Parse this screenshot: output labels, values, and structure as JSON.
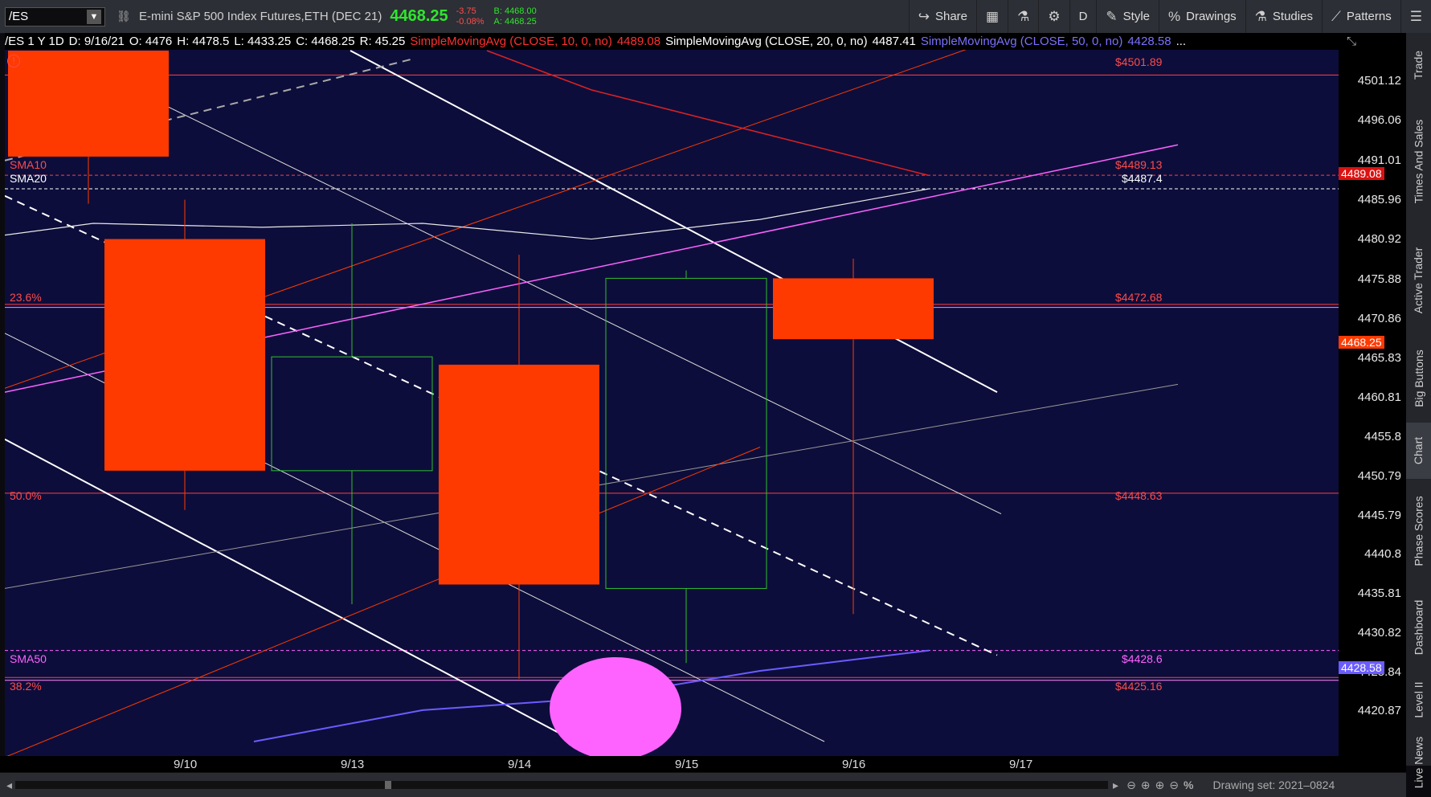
{
  "toolbar": {
    "symbol": "/ES",
    "description": "E-mini S&P 500 Index Futures,ETH (DEC 21)",
    "last": "4468.25",
    "change": "-3.75",
    "change_pct": "-0.08%",
    "bid": "B: 4468.00",
    "ask": "A: 4468.25",
    "share": "Share",
    "timeframe": "D",
    "style": "Style",
    "drawings": "Drawings",
    "studies": "Studies",
    "patterns": "Patterns"
  },
  "header": {
    "aggregation": "/ES 1 Y 1D",
    "date": "D: 9/16/21",
    "open": "O: 4476",
    "high": "H: 4478.5",
    "low": "L: 4433.25",
    "close": "C: 4468.25",
    "range": "R: 45.25",
    "sma10_label": "SimpleMovingAvg (CLOSE, 10, 0, no)",
    "sma10_value": "4489.08",
    "sma20_label": "SimpleMovingAvg (CLOSE, 20, 0, no)",
    "sma20_value": "4487.41",
    "sma50_label": "SimpleMovingAvg (CLOSE, 50, 0, no)",
    "sma50_value": "4428.58",
    "more": "..."
  },
  "axis": {
    "prices": [
      "4501.12",
      "4496.06",
      "4491.01",
      "4485.96",
      "4480.92",
      "4475.88",
      "4470.86",
      "4465.83",
      "4460.81",
      "4455.8",
      "4450.79",
      "4445.79",
      "4440.8",
      "4435.81",
      "4430.82",
      "4425.84",
      "4420.87"
    ],
    "dates": [
      "9/10",
      "9/13",
      "9/14",
      "9/15",
      "9/16",
      "9/17"
    ]
  },
  "levels": {
    "l4501": "$4501.89",
    "l4489": "$4489.13",
    "l4487": "$4487.4",
    "l4472": "$4472.68",
    "l4448": "$4448.63",
    "l4428": "$4428.6",
    "l4425": "$4425.16",
    "fib236": "23.6%",
    "fib500": "50.0%",
    "fib382": "38.2%",
    "sma10": "SMA10",
    "sma20": "SMA20",
    "sma50": "SMA50"
  },
  "badges": {
    "sma10": "4489.08",
    "last": "4468.25",
    "sma50": "4428.58"
  },
  "sidebar": [
    "Trade",
    "Times And Sales",
    "Active Trader",
    "Big Buttons",
    "Chart",
    "Phase Scores",
    "Dashboard",
    "Level II",
    "Live News"
  ],
  "footer": {
    "drawing_set": "Drawing set: 2021–0824",
    "zoom_pct": "%"
  },
  "chart_data": {
    "type": "candlestick",
    "categories": [
      "9/10",
      "9/13",
      "9/14",
      "9/15",
      "9/16"
    ],
    "series": [
      {
        "date": "9/10",
        "open": 4481,
        "high": 4486,
        "low": 4446.5,
        "close": 4451.5
      },
      {
        "date": "9/13",
        "open": 4451.5,
        "high": 4483,
        "low": 4434.5,
        "close": 4466
      },
      {
        "date": "9/14",
        "open": 4465,
        "high": 4479,
        "low": 4425,
        "close": 4437
      },
      {
        "date": "9/15",
        "open": 4436.5,
        "high": 4477,
        "low": 4427,
        "close": 4476
      },
      {
        "date": "9/16",
        "open": 4476,
        "high": 4478.5,
        "low": 4433.25,
        "close": 4468.25
      }
    ],
    "ylim": [
      4417,
      4505
    ],
    "colors": {
      "down": "#ff3a00",
      "up": "#2fbf2f",
      "sma10": "#d22",
      "sma20": "#e8e8e8",
      "sma50": "#6a5cff",
      "fib": "#ff4040"
    }
  }
}
